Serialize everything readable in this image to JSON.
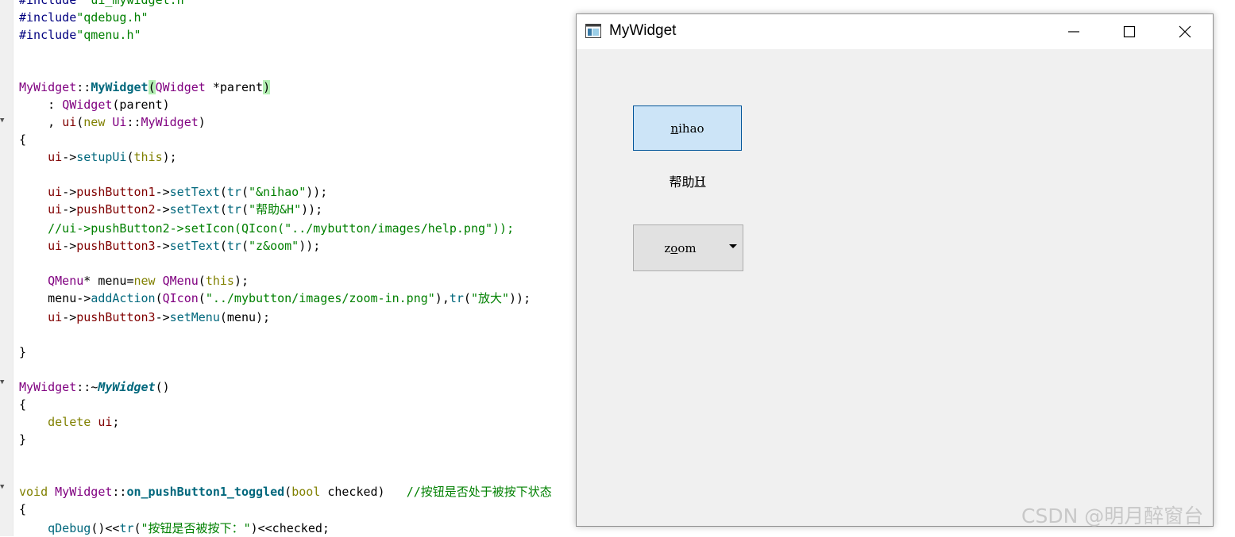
{
  "editor": {
    "lines": [
      [
        {
          "t": "#include ",
          "c": "dir"
        },
        {
          "t": "\"ui_mywidget.h\"",
          "c": "str"
        }
      ],
      [
        {
          "t": "#include",
          "c": "dir"
        },
        {
          "t": "\"qdebug.h\"",
          "c": "str"
        }
      ],
      [
        {
          "t": "#include",
          "c": "dir"
        },
        {
          "t": "\"qmenu.h\"",
          "c": "str"
        }
      ],
      [],
      [],
      [
        {
          "t": "MyWidget",
          "c": "cls"
        },
        {
          "t": "::",
          "c": "pl"
        },
        {
          "t": "MyWidget",
          "c": "fnb"
        },
        {
          "t": "(",
          "c": "hl"
        },
        {
          "t": "QWidget",
          "c": "cls"
        },
        {
          "t": " *parent",
          "c": "pl"
        },
        {
          "t": ")",
          "c": "hl"
        }
      ],
      [
        {
          "t": "    : ",
          "c": "pl"
        },
        {
          "t": "QWidget",
          "c": "cls"
        },
        {
          "t": "(parent)",
          "c": "pl"
        }
      ],
      [
        {
          "t": "    , ",
          "c": "pl"
        },
        {
          "t": "ui",
          "c": "mem"
        },
        {
          "t": "(",
          "c": "pl"
        },
        {
          "t": "new",
          "c": "kw"
        },
        {
          "t": " ",
          "c": "pl"
        },
        {
          "t": "Ui",
          "c": "cls"
        },
        {
          "t": "::",
          "c": "pl"
        },
        {
          "t": "MyWidget",
          "c": "cls"
        },
        {
          "t": ")",
          "c": "pl"
        }
      ],
      [
        {
          "t": "{",
          "c": "pl"
        }
      ],
      [
        {
          "t": "    ",
          "c": "pl"
        },
        {
          "t": "ui",
          "c": "mem"
        },
        {
          "t": "->",
          "c": "pl"
        },
        {
          "t": "setupUi",
          "c": "fn"
        },
        {
          "t": "(",
          "c": "pl"
        },
        {
          "t": "this",
          "c": "kw"
        },
        {
          "t": ");",
          "c": "pl"
        }
      ],
      [],
      [
        {
          "t": "    ",
          "c": "pl"
        },
        {
          "t": "ui",
          "c": "mem"
        },
        {
          "t": "->",
          "c": "pl"
        },
        {
          "t": "pushButton1",
          "c": "mem"
        },
        {
          "t": "->",
          "c": "pl"
        },
        {
          "t": "setText",
          "c": "fn"
        },
        {
          "t": "(",
          "c": "pl"
        },
        {
          "t": "tr",
          "c": "fn"
        },
        {
          "t": "(",
          "c": "pl"
        },
        {
          "t": "\"&nihao\"",
          "c": "str"
        },
        {
          "t": "));",
          "c": "pl"
        }
      ],
      [
        {
          "t": "    ",
          "c": "pl"
        },
        {
          "t": "ui",
          "c": "mem"
        },
        {
          "t": "->",
          "c": "pl"
        },
        {
          "t": "pushButton2",
          "c": "mem"
        },
        {
          "t": "->",
          "c": "pl"
        },
        {
          "t": "setText",
          "c": "fn"
        },
        {
          "t": "(",
          "c": "pl"
        },
        {
          "t": "tr",
          "c": "fn"
        },
        {
          "t": "(",
          "c": "pl"
        },
        {
          "t": "\"帮助&H\"",
          "c": "str"
        },
        {
          "t": "));",
          "c": "pl"
        }
      ],
      [
        {
          "t": "    //ui->pushButton2->setIcon(QIcon(\"../mybutton/images/help.png\"));",
          "c": "cmt"
        }
      ],
      [
        {
          "t": "    ",
          "c": "pl"
        },
        {
          "t": "ui",
          "c": "mem"
        },
        {
          "t": "->",
          "c": "pl"
        },
        {
          "t": "pushButton3",
          "c": "mem"
        },
        {
          "t": "->",
          "c": "pl"
        },
        {
          "t": "setText",
          "c": "fn"
        },
        {
          "t": "(",
          "c": "pl"
        },
        {
          "t": "tr",
          "c": "fn"
        },
        {
          "t": "(",
          "c": "pl"
        },
        {
          "t": "\"z&oom\"",
          "c": "str"
        },
        {
          "t": "));",
          "c": "pl"
        }
      ],
      [],
      [
        {
          "t": "    ",
          "c": "pl"
        },
        {
          "t": "QMenu",
          "c": "cls"
        },
        {
          "t": "* menu=",
          "c": "pl"
        },
        {
          "t": "new",
          "c": "kw"
        },
        {
          "t": " ",
          "c": "pl"
        },
        {
          "t": "QMenu",
          "c": "cls"
        },
        {
          "t": "(",
          "c": "pl"
        },
        {
          "t": "this",
          "c": "kw"
        },
        {
          "t": ");",
          "c": "pl"
        }
      ],
      [
        {
          "t": "    menu->",
          "c": "pl"
        },
        {
          "t": "addAction",
          "c": "fn"
        },
        {
          "t": "(",
          "c": "pl"
        },
        {
          "t": "QIcon",
          "c": "cls"
        },
        {
          "t": "(",
          "c": "pl"
        },
        {
          "t": "\"../mybutton/images/zoom-in.png\"",
          "c": "str"
        },
        {
          "t": "),",
          "c": "pl"
        },
        {
          "t": "tr",
          "c": "fn"
        },
        {
          "t": "(",
          "c": "pl"
        },
        {
          "t": "\"放大\"",
          "c": "str"
        },
        {
          "t": "));",
          "c": "pl"
        }
      ],
      [
        {
          "t": "    ",
          "c": "pl"
        },
        {
          "t": "ui",
          "c": "mem"
        },
        {
          "t": "->",
          "c": "pl"
        },
        {
          "t": "pushButton3",
          "c": "mem"
        },
        {
          "t": "->",
          "c": "pl"
        },
        {
          "t": "setMenu",
          "c": "fn"
        },
        {
          "t": "(menu);",
          "c": "pl"
        }
      ],
      [],
      [
        {
          "t": "}",
          "c": "pl"
        }
      ],
      [],
      [
        {
          "t": "MyWidget",
          "c": "cls"
        },
        {
          "t": "::~",
          "c": "pl"
        },
        {
          "t": "MyWidget",
          "c": "fni"
        },
        {
          "t": "()",
          "c": "pl"
        }
      ],
      [
        {
          "t": "{",
          "c": "pl"
        }
      ],
      [
        {
          "t": "    ",
          "c": "pl"
        },
        {
          "t": "delete",
          "c": "kw"
        },
        {
          "t": " ",
          "c": "pl"
        },
        {
          "t": "ui",
          "c": "mem"
        },
        {
          "t": ";",
          "c": "pl"
        }
      ],
      [
        {
          "t": "}",
          "c": "pl"
        }
      ],
      [],
      [],
      [
        {
          "t": "void",
          "c": "kw"
        },
        {
          "t": " ",
          "c": "pl"
        },
        {
          "t": "MyWidget",
          "c": "cls"
        },
        {
          "t": "::",
          "c": "pl"
        },
        {
          "t": "on_pushButton1_toggled",
          "c": "fnb"
        },
        {
          "t": "(",
          "c": "pl"
        },
        {
          "t": "bool",
          "c": "kw"
        },
        {
          "t": " checked)   ",
          "c": "pl"
        },
        {
          "t": "//按钮是否处于被按下状态",
          "c": "cmt"
        }
      ],
      [
        {
          "t": "{",
          "c": "pl"
        }
      ],
      [
        {
          "t": "    ",
          "c": "pl"
        },
        {
          "t": "qDebug",
          "c": "fn"
        },
        {
          "t": "()<<",
          "c": "pl"
        },
        {
          "t": "tr",
          "c": "fn"
        },
        {
          "t": "(",
          "c": "pl"
        },
        {
          "t": "\"按钮是否被按下：\"",
          "c": "str"
        },
        {
          "t": ")<<checked;",
          "c": "pl"
        }
      ]
    ]
  },
  "window": {
    "title": "MyWidget",
    "minimize_icon": "minimize-icon",
    "maximize_icon": "maximize-icon",
    "close_icon": "close-icon",
    "buttons": {
      "nihao": {
        "mnemonic": "n",
        "rest": "ihao"
      },
      "help": {
        "prefix": "帮助",
        "mnemonic": "H"
      },
      "zoom": {
        "prefix": "z",
        "mnemonic": "o",
        "rest": "om",
        "menu_arrow": "dropdown-arrow-icon"
      }
    }
  },
  "watermark": "CSDN @明月醉窗台"
}
